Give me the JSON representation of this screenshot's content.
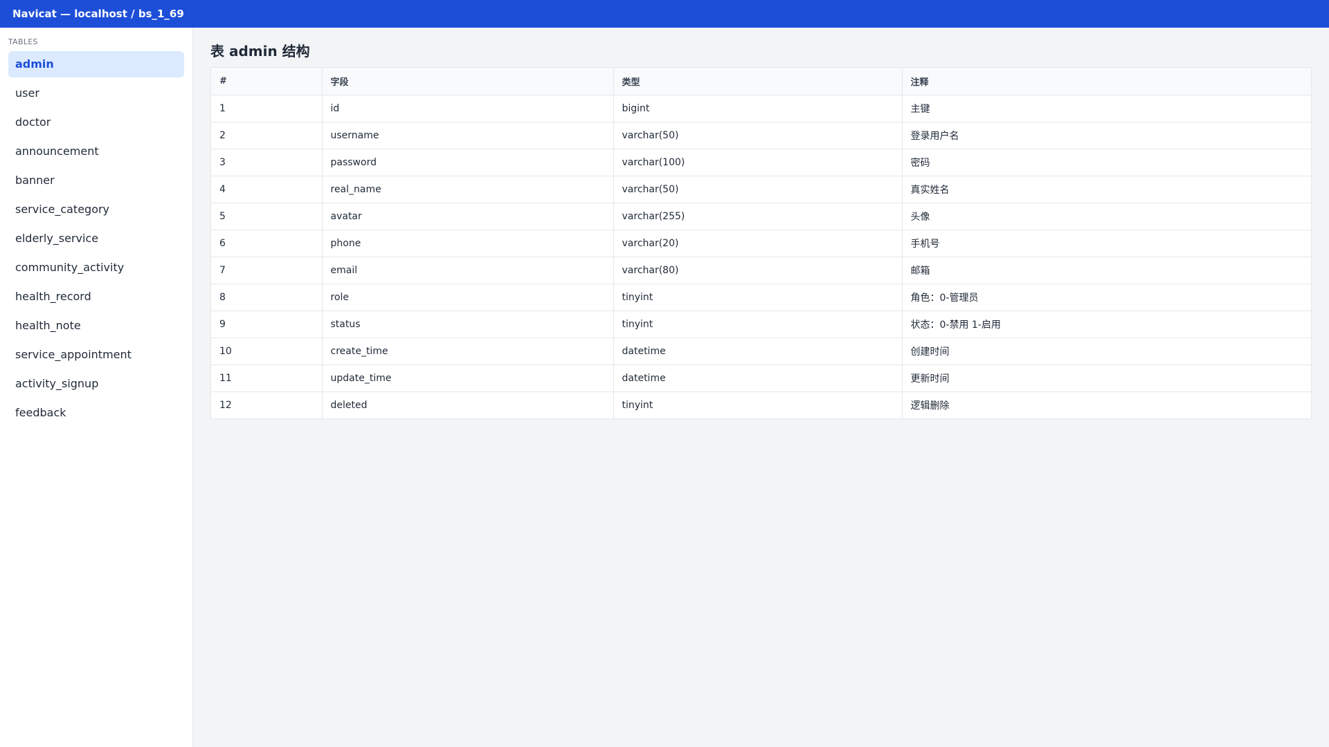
{
  "window": {
    "title": "Navicat — localhost / bs_1_69"
  },
  "sidebar": {
    "heading": "TABLES",
    "items": [
      {
        "label": "admin",
        "active": true
      },
      {
        "label": "user"
      },
      {
        "label": "doctor"
      },
      {
        "label": "announcement"
      },
      {
        "label": "banner"
      },
      {
        "label": "service_category"
      },
      {
        "label": "elderly_service"
      },
      {
        "label": "community_activity"
      },
      {
        "label": "health_record"
      },
      {
        "label": "health_note"
      },
      {
        "label": "service_appointment"
      },
      {
        "label": "activity_signup"
      },
      {
        "label": "feedback"
      }
    ]
  },
  "main": {
    "title": "表 admin 结构",
    "table": {
      "headers": [
        "#",
        "字段",
        "类型",
        "注释"
      ],
      "rows": [
        [
          "1",
          "id",
          "bigint",
          "主键"
        ],
        [
          "2",
          "username",
          "varchar(50)",
          "登录用户名"
        ],
        [
          "3",
          "password",
          "varchar(100)",
          "密码"
        ],
        [
          "4",
          "real_name",
          "varchar(50)",
          "真实姓名"
        ],
        [
          "5",
          "avatar",
          "varchar(255)",
          "头像"
        ],
        [
          "6",
          "phone",
          "varchar(20)",
          "手机号"
        ],
        [
          "7",
          "email",
          "varchar(80)",
          "邮箱"
        ],
        [
          "8",
          "role",
          "tinyint",
          "角色：0-管理员"
        ],
        [
          "9",
          "status",
          "tinyint",
          "状态：0-禁用 1-启用"
        ],
        [
          "10",
          "create_time",
          "datetime",
          "创建时间"
        ],
        [
          "11",
          "update_time",
          "datetime",
          "更新时间"
        ],
        [
          "12",
          "deleted",
          "tinyint",
          "逻辑删除"
        ]
      ]
    }
  },
  "colors": {
    "titlebar": "#1d4ed8",
    "active_item_bg": "#dbeafe",
    "active_item_text": "#1d4ed8",
    "page_bg": "#f3f4f6"
  }
}
